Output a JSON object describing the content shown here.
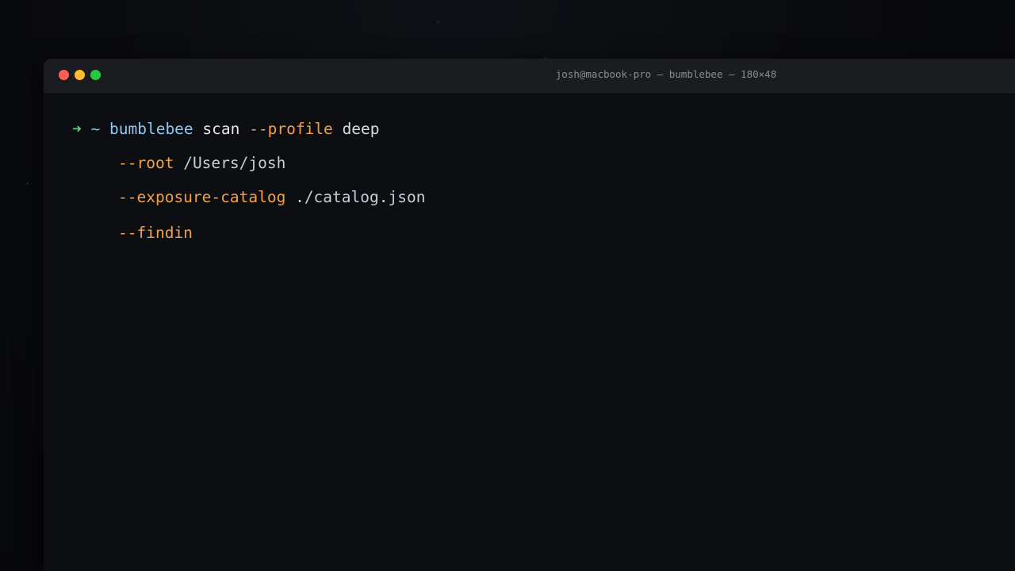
{
  "window": {
    "title": "josh@macbook-pro — bumblebee — 180×48"
  },
  "terminal": {
    "prompt_arrow": "➜",
    "prompt_path": "~",
    "lines": [
      {
        "command": "bumblebee",
        "subcommand": "scan",
        "flag": "--profile",
        "value": "deep"
      },
      {
        "flag": "--root",
        "value": "/Users/josh"
      },
      {
        "flag": "--exposure-catalog",
        "value": "./catalog.json"
      },
      {
        "flag": "--findin"
      }
    ]
  },
  "colors": {
    "close": "#fe5f57",
    "minimize": "#febc2e",
    "zoom": "#28c840",
    "prompt_arrow": "#5fd07a",
    "command": "#8ec9f0",
    "flag": "#f0a14a"
  }
}
